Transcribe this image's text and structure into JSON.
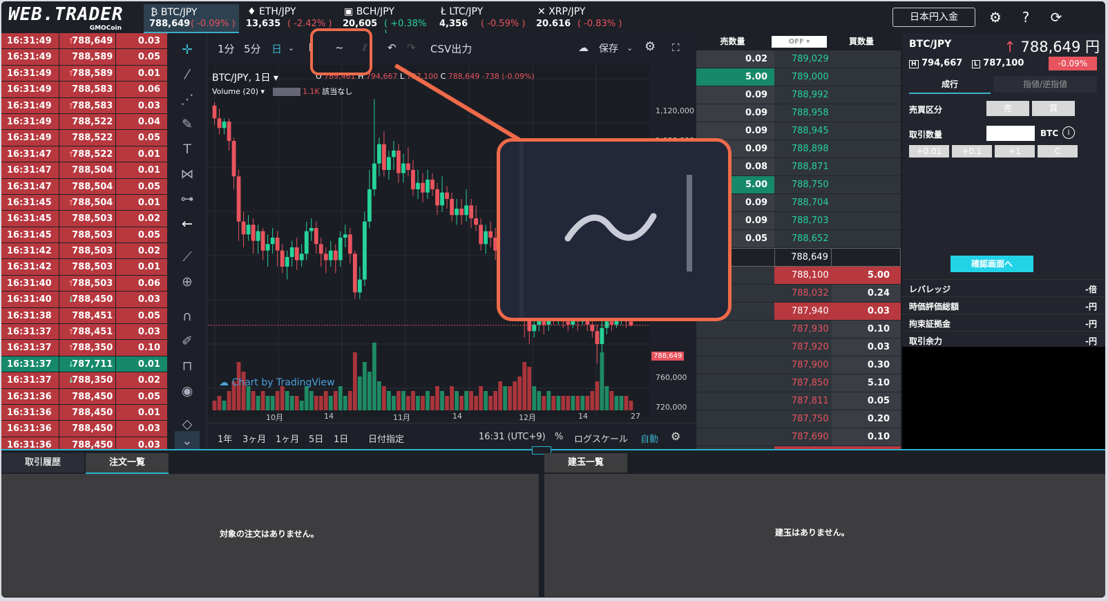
{
  "logo": {
    "main": "WEB.TRADER",
    "sub": "GMOCoin"
  },
  "tickers": [
    {
      "pair": "BTC/JPY",
      "price": "788,649",
      "change": "( -0.09% )",
      "dir": "neg",
      "active": true
    },
    {
      "pair": "ETH/JPY",
      "price": "13,635",
      "change": "( -2.42% )",
      "dir": "neg",
      "active": false
    },
    {
      "pair": "BCH/JPY",
      "price": "20,605",
      "change": "( +0.38% )",
      "dir": "pos",
      "active": false
    },
    {
      "pair": "LTC/JPY",
      "price": "4,356",
      "change": "( -0.59% )",
      "dir": "neg",
      "active": false
    },
    {
      "pair": "XRP/JPY",
      "price": "20.616",
      "change": "( -0.83% )",
      "dir": "neg",
      "active": false
    }
  ],
  "header": {
    "deposit_label": "日本円入金",
    "settings_icon": "gear-icon",
    "help_icon": "question-icon",
    "refresh_icon": "refresh-icon"
  },
  "trades": [
    {
      "time": "16:31:49",
      "price": "788,649",
      "amount": "0.03",
      "arrow": "up",
      "side": "sell"
    },
    {
      "time": "16:31:49",
      "price": "788,589",
      "amount": "0.05",
      "arrow": "",
      "side": "sell"
    },
    {
      "time": "16:31:49",
      "price": "788,589",
      "amount": "0.01",
      "arrow": "up",
      "side": "sell"
    },
    {
      "time": "16:31:49",
      "price": "788,583",
      "amount": "0.06",
      "arrow": "",
      "side": "sell"
    },
    {
      "time": "16:31:49",
      "price": "788,583",
      "amount": "0.03",
      "arrow": "up",
      "side": "sell"
    },
    {
      "time": "16:31:49",
      "price": "788,522",
      "amount": "0.04",
      "arrow": "",
      "side": "sell"
    },
    {
      "time": "16:31:49",
      "price": "788,522",
      "amount": "0.05",
      "arrow": "",
      "side": "sell"
    },
    {
      "time": "16:31:47",
      "price": "788,522",
      "amount": "0.01",
      "arrow": "up",
      "side": "sell"
    },
    {
      "time": "16:31:47",
      "price": "788,504",
      "amount": "0.01",
      "arrow": "",
      "side": "sell"
    },
    {
      "time": "16:31:47",
      "price": "788,504",
      "amount": "0.05",
      "arrow": "",
      "side": "sell"
    },
    {
      "time": "16:31:45",
      "price": "788,504",
      "amount": "0.01",
      "arrow": "up",
      "side": "sell"
    },
    {
      "time": "16:31:45",
      "price": "788,503",
      "amount": "0.02",
      "arrow": "",
      "side": "sell"
    },
    {
      "time": "16:31:45",
      "price": "788,503",
      "amount": "0.05",
      "arrow": "",
      "side": "sell"
    },
    {
      "time": "16:31:42",
      "price": "788,503",
      "amount": "0.02",
      "arrow": "",
      "side": "sell"
    },
    {
      "time": "16:31:42",
      "price": "788,503",
      "amount": "0.01",
      "arrow": "",
      "side": "sell"
    },
    {
      "time": "16:31:40",
      "price": "788,503",
      "amount": "0.06",
      "arrow": "up",
      "side": "sell"
    },
    {
      "time": "16:31:40",
      "price": "788,450",
      "amount": "0.03",
      "arrow": "down",
      "side": "sell"
    },
    {
      "time": "16:31:38",
      "price": "788,451",
      "amount": "0.05",
      "arrow": "",
      "side": "sell"
    },
    {
      "time": "16:31:37",
      "price": "788,451",
      "amount": "0.03",
      "arrow": "up",
      "side": "sell"
    },
    {
      "time": "16:31:37",
      "price": "788,350",
      "amount": "0.10",
      "arrow": "up",
      "side": "sell"
    },
    {
      "time": "16:31:37",
      "price": "787,711",
      "amount": "0.01",
      "arrow": "down",
      "side": "buy"
    },
    {
      "time": "16:31:37",
      "price": "788,350",
      "amount": "0.02",
      "arrow": "down",
      "side": "sell"
    },
    {
      "time": "16:31:36",
      "price": "788,450",
      "amount": "0.05",
      "arrow": "",
      "side": "sell"
    },
    {
      "time": "16:31:36",
      "price": "788,450",
      "amount": "0.01",
      "arrow": "",
      "side": "sell"
    },
    {
      "time": "16:31:36",
      "price": "788,450",
      "amount": "0.03",
      "arrow": "",
      "side": "sell"
    },
    {
      "time": "16:31:36",
      "price": "788,450",
      "amount": "0.03",
      "arrow": "",
      "side": "sell"
    }
  ],
  "chart": {
    "intervals": [
      "1分",
      "5分",
      "日"
    ],
    "active_interval": "日",
    "csv_label": "CSV出力",
    "save_label": "保存",
    "symbol_label": "BTC/JPY, 1日",
    "ohlc": {
      "o_label": "O",
      "o": "789,461",
      "h_label": "H",
      "h": "794,667",
      "l_label": "L",
      "l": "787,100",
      "c_label": "C",
      "c": "788,649",
      "chg": "-738 (-0.09%)"
    },
    "volume_label": "Volume (20)",
    "volume_value": "1.1K",
    "volume_note": "該当なし",
    "watermark": "Chart by TradingView",
    "y_ticks": [
      "1,120,000",
      "1,080,000",
      "800,000",
      "760,000",
      "720,000"
    ],
    "price_tag": "788,649",
    "x_ticks": [
      "10月",
      "14",
      "11月",
      "14",
      "12月",
      "14",
      "27"
    ],
    "ranges": [
      "1年",
      "3ヶ月",
      "1ヶ月",
      "5日",
      "1日"
    ],
    "date_range_label": "日付指定",
    "clock": "16:31 (UTC+9)",
    "percent_label": "%",
    "log_label": "ログスケール",
    "auto_label": "自動"
  },
  "book": {
    "sell_header": "売数量",
    "toggle": "OFF",
    "buy_header": "買数量",
    "asks": [
      {
        "qty": "0.02",
        "price": "789,029",
        "hi": false
      },
      {
        "qty": "5.00",
        "price": "789,000",
        "hi": true
      },
      {
        "qty": "0.09",
        "price": "788,992",
        "hi": false
      },
      {
        "qty": "0.09",
        "price": "788,958",
        "hi": false
      },
      {
        "qty": "0.09",
        "price": "788,945",
        "hi": false
      },
      {
        "qty": "0.09",
        "price": "788,898",
        "hi": false
      },
      {
        "qty": "0.08",
        "price": "788,871",
        "hi": false
      },
      {
        "qty": "5.00",
        "price": "788,750",
        "hi": true
      },
      {
        "qty": "0.09",
        "price": "788,704",
        "hi": false
      },
      {
        "qty": "0.09",
        "price": "788,703",
        "hi": false
      },
      {
        "qty": "0.05",
        "price": "788,652",
        "hi": false
      }
    ],
    "mid": "788,649",
    "bids": [
      {
        "qty": "5.00",
        "price": "788,100",
        "hi": true
      },
      {
        "qty": "0.24",
        "price": "788,032",
        "hi": false
      },
      {
        "qty": "0.03",
        "price": "787,940",
        "hi": true
      },
      {
        "qty": "0.10",
        "price": "787,930",
        "hi": false
      },
      {
        "qty": "0.03",
        "price": "787,920",
        "hi": false
      },
      {
        "qty": "0.30",
        "price": "787,900",
        "hi": false
      },
      {
        "qty": "5.10",
        "price": "787,850",
        "hi": false
      },
      {
        "qty": "0.05",
        "price": "787,811",
        "hi": false
      },
      {
        "qty": "0.20",
        "price": "787,750",
        "hi": false
      },
      {
        "qty": "0.10",
        "price": "787,690",
        "hi": false
      },
      {
        "qty": "0.25",
        "price": "787,640",
        "hi": true
      }
    ]
  },
  "order": {
    "pair": "BTC/JPY",
    "price": "788,649 円",
    "high_label": "H",
    "high": "794,667",
    "low_label": "L",
    "low": "787,100",
    "change": "-0.09%",
    "tabs": [
      "成行",
      "指値/逆指値"
    ],
    "side_label": "売買区分",
    "sell_btn": "売",
    "buy_btn": "買",
    "qty_label": "取引数量",
    "qty_unit": "BTC",
    "steps": [
      "+0.01",
      "+0.1",
      "+1",
      "C"
    ],
    "confirm": "確認画面へ",
    "summary": [
      {
        "label": "レバレッジ",
        "value": "-倍"
      },
      {
        "label": "時価評価総額",
        "value": "-円"
      },
      {
        "label": "拘束証拠金",
        "value": "-円"
      },
      {
        "label": "取引余力",
        "value": "-円"
      }
    ]
  },
  "bottom": {
    "left_tabs": [
      "取引履歴",
      "注文一覧"
    ],
    "left_active": 1,
    "left_empty": "対象の注文はありません。",
    "right_tab": "建玉一覧",
    "right_empty": "建玉はありません。"
  },
  "candles": [
    [
      1130,
      1110,
      1135,
      1100
    ],
    [
      1110,
      1095,
      1125,
      1085
    ],
    [
      1095,
      1105,
      1110,
      1085
    ],
    [
      1105,
      1075,
      1110,
      1060
    ],
    [
      1075,
      1020,
      1080,
      1000
    ],
    [
      1020,
      950,
      1030,
      920
    ],
    [
      950,
      930,
      965,
      910
    ],
    [
      930,
      945,
      960,
      920
    ],
    [
      945,
      920,
      955,
      900
    ],
    [
      920,
      935,
      945,
      900
    ],
    [
      935,
      905,
      940,
      890
    ],
    [
      905,
      915,
      930,
      880
    ],
    [
      915,
      925,
      940,
      900
    ],
    [
      925,
      905,
      935,
      880
    ],
    [
      905,
      880,
      915,
      870
    ],
    [
      880,
      895,
      905,
      860
    ],
    [
      895,
      910,
      920,
      880
    ],
    [
      910,
      890,
      925,
      875
    ],
    [
      890,
      900,
      915,
      880
    ],
    [
      900,
      935,
      950,
      890
    ],
    [
      935,
      940,
      955,
      920
    ],
    [
      940,
      915,
      950,
      900
    ],
    [
      915,
      900,
      925,
      880
    ],
    [
      900,
      890,
      910,
      870
    ],
    [
      890,
      905,
      920,
      880
    ],
    [
      905,
      890,
      915,
      870
    ],
    [
      890,
      925,
      935,
      880
    ],
    [
      925,
      930,
      945,
      910
    ],
    [
      930,
      900,
      940,
      885
    ],
    [
      900,
      840,
      905,
      830
    ],
    [
      840,
      860,
      880,
      830
    ],
    [
      860,
      950,
      965,
      850
    ],
    [
      950,
      1000,
      1030,
      940
    ],
    [
      1000,
      1040,
      1140,
      990
    ],
    [
      1040,
      1070,
      1080,
      1020
    ],
    [
      1070,
      1030,
      1090,
      1020
    ],
    [
      1030,
      1050,
      1060,
      1015
    ],
    [
      1050,
      1060,
      1075,
      1030
    ],
    [
      1060,
      1025,
      1070,
      1010
    ],
    [
      1025,
      1040,
      1055,
      1010
    ],
    [
      1040,
      1030,
      1065,
      1020
    ],
    [
      1030,
      1000,
      1045,
      990
    ],
    [
      1000,
      1010,
      1030,
      985
    ],
    [
      1010,
      995,
      1025,
      980
    ],
    [
      995,
      1015,
      1030,
      985
    ],
    [
      1015,
      1000,
      1025,
      990
    ],
    [
      1000,
      975,
      1010,
      960
    ],
    [
      975,
      995,
      1020,
      965
    ],
    [
      995,
      985,
      1005,
      970
    ],
    [
      985,
      960,
      995,
      950
    ],
    [
      960,
      970,
      985,
      945
    ],
    [
      970,
      960,
      985,
      945
    ],
    [
      960,
      975,
      1000,
      950
    ],
    [
      975,
      955,
      985,
      940
    ],
    [
      955,
      945,
      975,
      935
    ],
    [
      945,
      915,
      955,
      905
    ],
    [
      915,
      935,
      945,
      900
    ],
    [
      935,
      925,
      950,
      910
    ],
    [
      925,
      905,
      940,
      890
    ],
    [
      905,
      880,
      915,
      870
    ],
    [
      880,
      895,
      905,
      860
    ],
    [
      895,
      870,
      900,
      850
    ],
    [
      870,
      845,
      880,
      830
    ],
    [
      845,
      820,
      855,
      810
    ],
    [
      820,
      800,
      830,
      770
    ],
    [
      800,
      780,
      810,
      760
    ],
    [
      780,
      790,
      805,
      770
    ],
    [
      790,
      800,
      815,
      780
    ],
    [
      800,
      790,
      810,
      775
    ],
    [
      790,
      805,
      820,
      780
    ],
    [
      805,
      800,
      815,
      790
    ],
    [
      800,
      810,
      820,
      790
    ],
    [
      810,
      795,
      820,
      785
    ],
    [
      795,
      790,
      805,
      780
    ],
    [
      790,
      800,
      815,
      785
    ],
    [
      800,
      795,
      810,
      780
    ],
    [
      795,
      805,
      820,
      790
    ],
    [
      805,
      790,
      815,
      780
    ],
    [
      790,
      780,
      800,
      770
    ],
    [
      780,
      760,
      790,
      730
    ],
    [
      760,
      785,
      795,
      745
    ],
    [
      785,
      795,
      800,
      775
    ],
    [
      795,
      790,
      805,
      780
    ],
    [
      790,
      800,
      810,
      785
    ],
    [
      800,
      805,
      815,
      790
    ],
    [
      805,
      795,
      815,
      785
    ],
    [
      795,
      789,
      800,
      787
    ]
  ],
  "volumes": [
    2,
    3,
    2,
    4,
    6,
    10,
    8,
    5,
    4,
    3,
    4,
    3,
    3,
    4,
    5,
    4,
    3,
    3,
    2,
    5,
    4,
    3,
    3,
    4,
    3,
    4,
    5,
    3,
    4,
    12,
    7,
    10,
    8,
    14,
    6,
    5,
    4,
    3,
    4,
    4,
    3,
    4,
    3,
    3,
    4,
    3,
    5,
    4,
    3,
    5,
    4,
    3,
    4,
    4,
    3,
    5,
    4,
    3,
    4,
    6,
    5,
    5,
    6,
    7,
    10,
    9,
    5,
    4,
    3,
    4,
    3,
    3,
    3,
    3,
    3,
    3,
    3,
    3,
    4,
    6,
    12,
    5,
    4,
    3,
    3,
    3,
    2
  ]
}
